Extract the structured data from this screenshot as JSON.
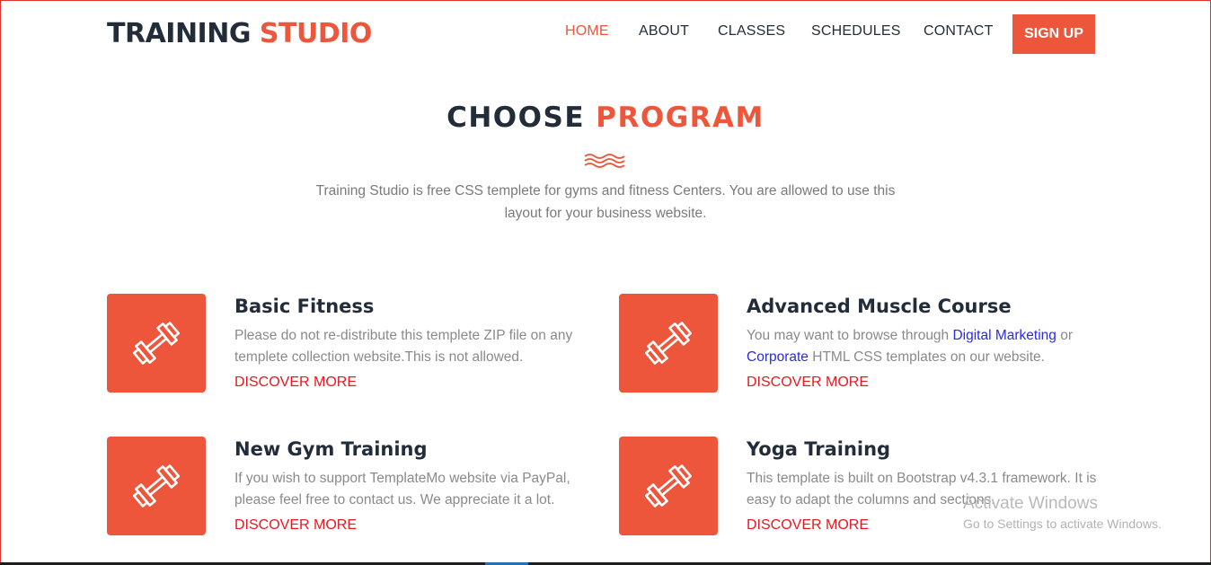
{
  "brand": {
    "part1": "TRAINING",
    "part2": "STUDIO"
  },
  "nav": {
    "items": [
      "HOME",
      "ABOUT",
      "CLASSES",
      "SCHEDULES",
      "CONTACT"
    ],
    "active": "HOME",
    "signup_label": "SIGN UP"
  },
  "section": {
    "title_part1": "CHOOSE",
    "title_part2": "PROGRAM",
    "intro_line1": "Training Studio is free CSS templete for gyms and fitness Centers. You are allowed to use this",
    "intro_line2": "layout for your business website."
  },
  "programs": [
    {
      "title": "Basic Fitness",
      "desc_line1": "Please do not re-distribute this templete ZIP file on any",
      "desc_line2": "templete collection website.This is not allowed.",
      "more": "DISCOVER MORE"
    },
    {
      "title": "Advanced Muscle Course",
      "desc_pre": "You may want to browse through ",
      "desc_link1": "Digital Marketing",
      "desc_mid": " or",
      "desc_link2": "Corporate",
      "desc_post": " HTML CSS templates on our website.",
      "more": "DISCOVER MORE"
    },
    {
      "title": "New Gym Training",
      "desc_line1": "If you wish to support TemplateMo website via PayPal,",
      "desc_line2": "please feel free to contact us. We appreciate it a lot.",
      "more": "DISCOVER MORE"
    },
    {
      "title": "Yoga Training",
      "desc_line1": "This template is built on Bootstrap v4.3.1 framework. It is",
      "desc_line2": "easy to adapt the columns and sections.",
      "more": "DISCOVER MORE"
    }
  ],
  "watermark": {
    "line1": "Activate Windows",
    "line2": "Go to Settings to activate Windows."
  },
  "icons": {
    "program_icon": "dumbbell-icon",
    "divider_icon": "waves-icon"
  },
  "colors": {
    "accent": "#ed563b",
    "dark": "#232d39",
    "link": "#2b2be0",
    "discover": "#e8181f",
    "muted": "#7a7a7a"
  }
}
